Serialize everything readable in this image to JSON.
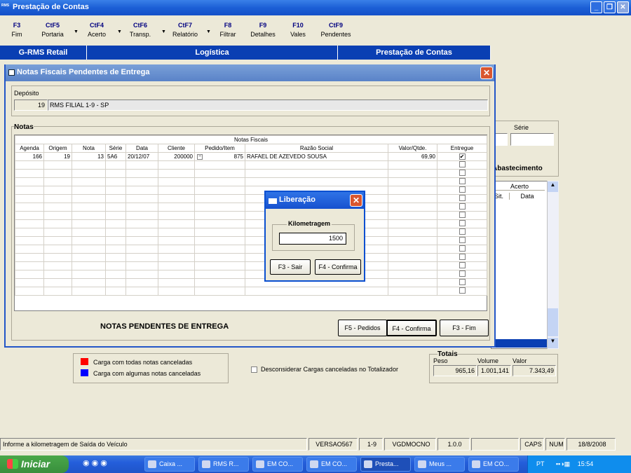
{
  "window": {
    "title": "Prestação de Contas",
    "app_icon": "RMS"
  },
  "toolbar": [
    {
      "key": "F3",
      "label": "Fim"
    },
    {
      "key": "CtF5",
      "label": "Portaria"
    },
    {
      "key": "CtF4",
      "label": "Acerto"
    },
    {
      "key": "CtF6",
      "label": "Transp."
    },
    {
      "key": "CtF7",
      "label": "Relatório"
    },
    {
      "key": "F8",
      "label": "Filtrar"
    },
    {
      "key": "F9",
      "label": "Detalhes"
    },
    {
      "key": "F10",
      "label": "Vales"
    },
    {
      "key": "CtF9",
      "label": "Pendentes"
    }
  ],
  "bluebar": {
    "a": "G-RMS Retail",
    "b": "Logística",
    "c": "Prestação de Contas"
  },
  "back": {
    "serie_label": "Série",
    "abastecimento": "Abastecimento",
    "acerto": "Acerto",
    "sit": "Sit.",
    "data": "Data",
    "legend1": "Carga com todas notas canceladas",
    "legend2": "Carga com algumas notas canceladas",
    "desconsiderar": "Desconsiderar Cargas canceladas no Totalizador",
    "totais": "Totais",
    "peso_label": "Peso",
    "volume_label": "Volume",
    "valor_label": "Valor",
    "peso": "965,16",
    "volume": "1.001,141",
    "valor": "7.343,49",
    "legend1_color": "#ff0000",
    "legend2_color": "#0000ff"
  },
  "dialog": {
    "title": "Notas Fiscais Pendentes de Entrega",
    "deposito_label": "Depósito",
    "deposito_code": "19",
    "deposito_name": "RMS FILIAL 1-9 - SP",
    "notas_label": "Notas",
    "nf_header": "Notas Fiscais",
    "columns": [
      "Agenda",
      "Origem",
      "Nota",
      "Série",
      "Data",
      "Cliente",
      "Pedido/Item",
      "Razão Social",
      "Valor/Qtde.",
      "Entregue"
    ],
    "row": {
      "agenda": "166",
      "origem": "19",
      "nota": "13",
      "serie": "5A6",
      "data": "20/12/07",
      "cliente": "200000",
      "pedido": "875",
      "razao": "RAFAEL DE AZEVEDO SOUSA",
      "valor": "69,90",
      "entregue": "✔"
    },
    "footer_title": "NOTAS PENDENTES DE ENTREGA",
    "btn_pedidos": "F5 - Pedidos",
    "btn_confirma": "F4 - Confirma",
    "btn_fim": "F3 - Fim"
  },
  "liberacao": {
    "title": "Liberação",
    "group": "Kilometragem",
    "value": "1500",
    "btn_sair": "F3 - Sair",
    "btn_confirma": "F4 - Confirma"
  },
  "status": {
    "msg": "Informe a kilometragem de Saída do Veículo",
    "versao": "VERSAO567",
    "filial": "1-9",
    "user": "VGDMOCNO",
    "ver": "1.0.0",
    "caps": "CAPS",
    "num": "NUM",
    "date": "18/8/2008"
  },
  "taskbar": {
    "start": "Iniciar",
    "tasks": [
      "Caixa ...",
      "RMS R...",
      "EM CO...",
      "EM CO...",
      "Presta...",
      "Meus ...",
      "EM CO..."
    ],
    "lang": "PT",
    "time": "15:54"
  }
}
